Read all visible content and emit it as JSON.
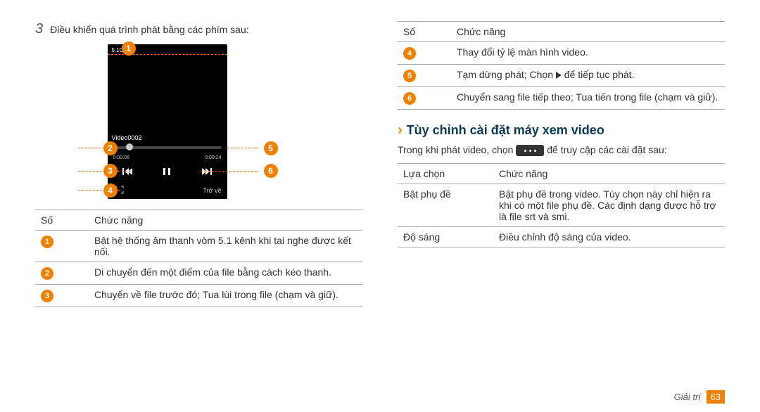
{
  "left": {
    "step_number": "3",
    "step_text": "Điều khiển quá trình phát bằng các phím sau:",
    "phone": {
      "top_indicator": "5.1Ch",
      "title": "Video0002",
      "time_left": "0:00:06",
      "time_right": "0:00:24",
      "back_label": "Trở về"
    },
    "table": {
      "h1": "Số",
      "h2": "Chức năng",
      "rows": [
        {
          "n": "1",
          "t": "Bật hệ thống âm thanh vòm 5.1 kênh khi tai nghe được kết nối."
        },
        {
          "n": "2",
          "t": "Di chuyển đến một điểm của file bằng cách kéo thanh."
        },
        {
          "n": "3",
          "t": "Chuyển về file trước đó; Tua lùi trong file (chạm và giữ)."
        }
      ]
    }
  },
  "right": {
    "table1": {
      "h1": "Số",
      "h2": "Chức năng",
      "rows": [
        {
          "n": "4",
          "t": "Thay đổi tỷ lệ màn hình video."
        },
        {
          "n": "5",
          "t_before": "Tạm dừng phát; Chọn ",
          "t_after": " để tiếp tục phát."
        },
        {
          "n": "6",
          "t": "Chuyển sang file tiếp theo; Tua tiến trong file (chạm và giữ)."
        }
      ]
    },
    "section_title": "Tùy chỉnh cài đặt máy xem video",
    "para_before": "Trong khi phát video, chọn ",
    "para_after": " để truy cập các cài đặt sau:",
    "table2": {
      "h1": "Lựa chọn",
      "h2": "Chức năng",
      "rows": [
        {
          "k": "Bật phụ đề",
          "v": "Bật phụ đề trong video. Tùy chọn này chỉ hiện ra khi có một file phụ đề. Các định dạng được hỗ trợ là file srt và smi."
        },
        {
          "k": "Độ sáng",
          "v": "Điều chỉnh độ sáng của video."
        }
      ]
    }
  },
  "footer": {
    "section": "Giải trí",
    "page": "63"
  }
}
